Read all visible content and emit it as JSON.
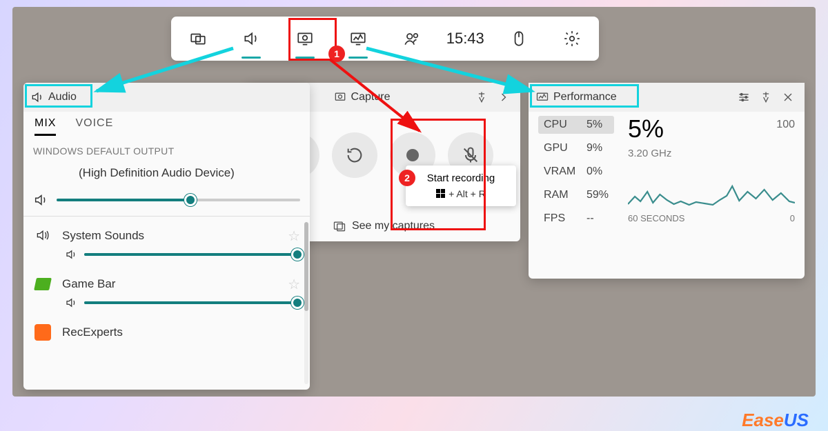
{
  "toolbar": {
    "time": "15:43",
    "items": [
      "widgets",
      "audio",
      "capture",
      "performance",
      "social",
      "time",
      "mouse",
      "settings"
    ]
  },
  "annotations": {
    "badge1": "1",
    "badge2": "2"
  },
  "audio": {
    "title": "Audio",
    "tabs": {
      "mix": "MIX",
      "voice": "VOICE"
    },
    "section": "WINDOWS DEFAULT OUTPUT",
    "device": "(High Definition Audio Device)",
    "master_volume_pct": 55,
    "apps": [
      {
        "name": "System Sounds",
        "volume_pct": 100
      },
      {
        "name": "Game Bar",
        "volume_pct": 100
      },
      {
        "name": "RecExperts",
        "volume_pct": 100
      }
    ]
  },
  "capture": {
    "title": "Capture",
    "tooltip_title": "Start recording",
    "tooltip_shortcut": "+ Alt + R",
    "see_link": "See my captures"
  },
  "performance": {
    "title": "Performance",
    "stats": {
      "cpu_label": "CPU",
      "cpu": "5%",
      "gpu_label": "GPU",
      "gpu": "9%",
      "vram_label": "VRAM",
      "vram": "0%",
      "ram_label": "RAM",
      "ram": "59%",
      "fps_label": "FPS",
      "fps": "--"
    },
    "big_pct": "5%",
    "y_max": "100",
    "clock": "3.20 GHz",
    "x_label": "60 SECONDS",
    "x_right": "0"
  },
  "chart_data": {
    "type": "line",
    "title": "CPU usage last 60 seconds",
    "xlabel": "60 SECONDS",
    "ylabel": "",
    "ylim": [
      0,
      100
    ],
    "x": [
      60,
      57,
      54,
      51,
      48,
      45,
      42,
      39,
      36,
      33,
      30,
      27,
      24,
      21,
      18,
      15,
      12,
      9,
      6,
      3,
      0
    ],
    "series": [
      {
        "name": "CPU %",
        "values": [
          4,
          12,
          6,
          18,
          5,
          14,
          8,
          4,
          6,
          3,
          5,
          4,
          3,
          6,
          10,
          22,
          7,
          16,
          9,
          18,
          6
        ]
      }
    ]
  },
  "watermark": {
    "a": "Ease",
    "b": "US"
  }
}
